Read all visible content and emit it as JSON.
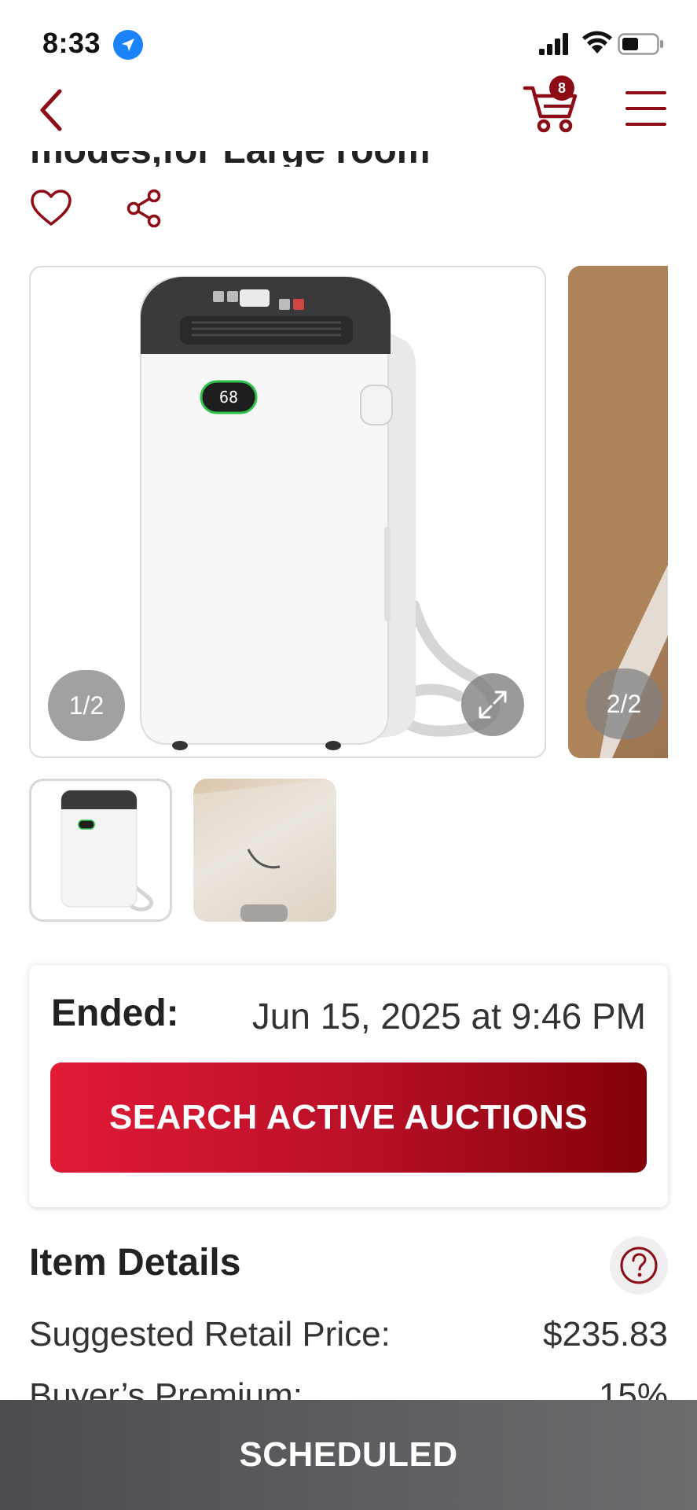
{
  "status_bar": {
    "time": "8:33"
  },
  "nav": {
    "cart_count": "8"
  },
  "product": {
    "title_fragment": "modes,for Large room"
  },
  "carousel": {
    "slides": [
      {
        "counter": "1/2"
      },
      {
        "counter": "2/2"
      }
    ]
  },
  "auction": {
    "ended_label": "Ended:",
    "ended_date": "Jun 15, 2025 at 9:46 PM",
    "search_button_label": "SEARCH ACTIVE AUCTIONS"
  },
  "item_details": {
    "heading": "Item Details",
    "rows": [
      {
        "label": "Suggested Retail Price:",
        "value": "$235.83"
      },
      {
        "label": "Buyer’s Premium:",
        "value": "15%"
      }
    ]
  },
  "bottom_bar": {
    "label": "SCHEDULED"
  },
  "colors": {
    "brand_red": "#8d0c16",
    "button_gradient_start": "#e21a37",
    "button_gradient_end": "#820008",
    "bottom_bar": "#5a5b5e"
  },
  "icons": [
    "location-arrow-icon",
    "signal-icon",
    "wifi-icon",
    "battery-icon",
    "back-chevron-icon",
    "cart-icon",
    "hamburger-menu-icon",
    "heart-icon",
    "share-icon",
    "expand-icon",
    "help-icon"
  ]
}
